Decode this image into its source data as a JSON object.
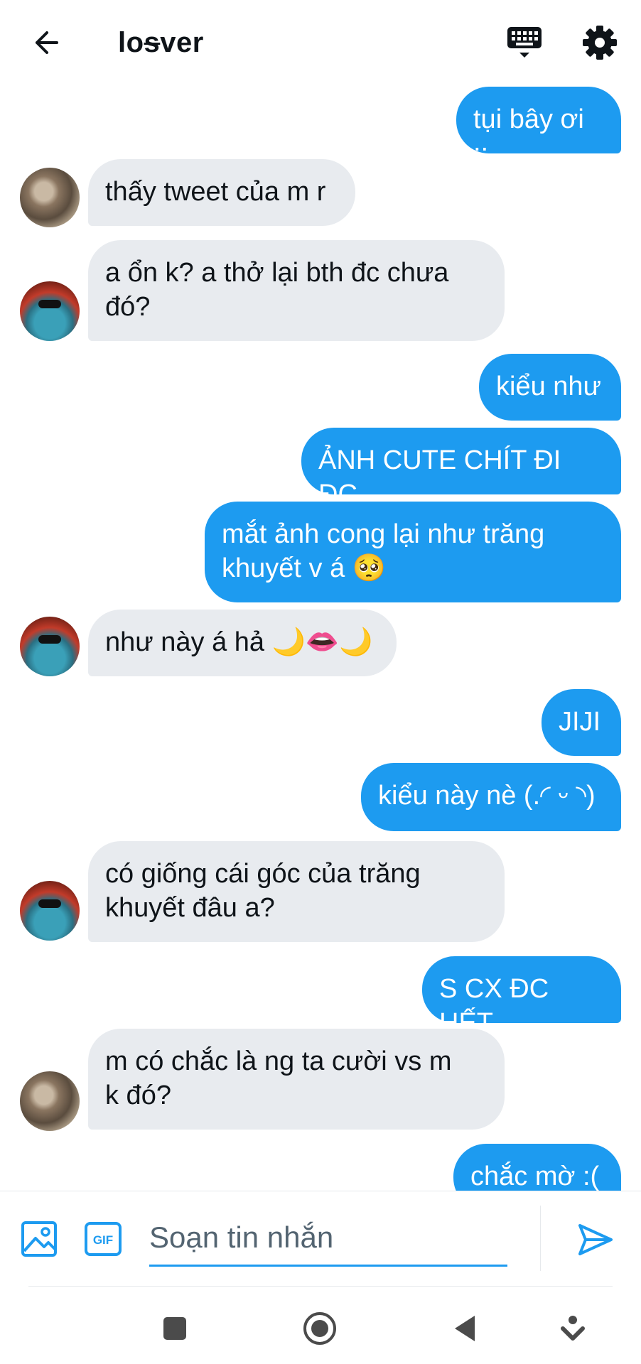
{
  "header": {
    "title_prefix": "lo",
    "title_strike": "s",
    "title_suffix": "ver",
    "icons": [
      "back-arrow-icon",
      "keyboard-icon",
      "gear-icon"
    ]
  },
  "messages": [
    {
      "side": "out",
      "text": "tụi bây ơi ;;"
    },
    {
      "side": "in",
      "avatar": "a",
      "text": "thấy tweet của m r"
    },
    {
      "side": "in",
      "avatar": "b",
      "text": "a ổn k? a thở lại bth đc chưa\nđó?"
    },
    {
      "side": "out",
      "text": "kiểu như"
    },
    {
      "side": "out",
      "text": "ẢNH CUTE CHÍT ĐI ĐC"
    },
    {
      "side": "out",
      "text": "mắt ảnh cong lại như trăng\nkhuyết v á 🥺"
    },
    {
      "side": "in",
      "avatar": "b",
      "text": "như này á hả 🌙👄🌙"
    },
    {
      "side": "out",
      "text": "JIJI"
    },
    {
      "side": "out",
      "text": "kiểu này nè (.◜ ᵕ ◝)"
    },
    {
      "side": "in",
      "avatar": "b",
      "text": "có giống cái góc của trăng\nkhuyết đâu a?"
    },
    {
      "side": "out",
      "text": "S CX ĐC HẾT"
    },
    {
      "side": "in",
      "avatar": "a",
      "text": "m có chắc là ng ta cười vs m\nk đó?"
    },
    {
      "side": "out",
      "text": "chắc mờ :("
    }
  ],
  "composer": {
    "placeholder": "Soạn tin nhắn",
    "gif_label": "GIF"
  },
  "colors": {
    "accent": "#1d9bf0",
    "incoming_bubble": "#e8ebef",
    "text": "#0f1419",
    "muted": "#536471"
  }
}
